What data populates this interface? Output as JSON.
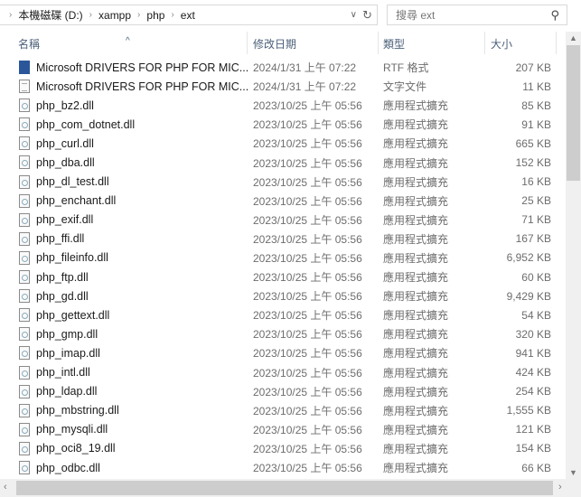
{
  "address": {
    "crumbs": [
      "本機磁碟 (D:)",
      "xampp",
      "php",
      "ext"
    ]
  },
  "search": {
    "placeholder": "搜尋 ext"
  },
  "columns": {
    "name": "名稱",
    "date": "修改日期",
    "type": "類型",
    "size": "大小"
  },
  "files": [
    {
      "name": "Microsoft DRIVERS FOR PHP FOR MIC...",
      "date": "2024/1/31 上午 07:22",
      "type": "RTF 格式",
      "size": "207 KB",
      "icon": "word"
    },
    {
      "name": "Microsoft DRIVERS FOR PHP FOR MIC...",
      "date": "2024/1/31 上午 07:22",
      "type": "文字文件",
      "size": "11 KB",
      "icon": "txt"
    },
    {
      "name": "php_bz2.dll",
      "date": "2023/10/25 上午 05:56",
      "type": "應用程式擴充",
      "size": "85 KB",
      "icon": "dll"
    },
    {
      "name": "php_com_dotnet.dll",
      "date": "2023/10/25 上午 05:56",
      "type": "應用程式擴充",
      "size": "91 KB",
      "icon": "dll"
    },
    {
      "name": "php_curl.dll",
      "date": "2023/10/25 上午 05:56",
      "type": "應用程式擴充",
      "size": "665 KB",
      "icon": "dll"
    },
    {
      "name": "php_dba.dll",
      "date": "2023/10/25 上午 05:56",
      "type": "應用程式擴充",
      "size": "152 KB",
      "icon": "dll"
    },
    {
      "name": "php_dl_test.dll",
      "date": "2023/10/25 上午 05:56",
      "type": "應用程式擴充",
      "size": "16 KB",
      "icon": "dll"
    },
    {
      "name": "php_enchant.dll",
      "date": "2023/10/25 上午 05:56",
      "type": "應用程式擴充",
      "size": "25 KB",
      "icon": "dll"
    },
    {
      "name": "php_exif.dll",
      "date": "2023/10/25 上午 05:56",
      "type": "應用程式擴充",
      "size": "71 KB",
      "icon": "dll"
    },
    {
      "name": "php_ffi.dll",
      "date": "2023/10/25 上午 05:56",
      "type": "應用程式擴充",
      "size": "167 KB",
      "icon": "dll"
    },
    {
      "name": "php_fileinfo.dll",
      "date": "2023/10/25 上午 05:56",
      "type": "應用程式擴充",
      "size": "6,952 KB",
      "icon": "dll"
    },
    {
      "name": "php_ftp.dll",
      "date": "2023/10/25 上午 05:56",
      "type": "應用程式擴充",
      "size": "60 KB",
      "icon": "dll"
    },
    {
      "name": "php_gd.dll",
      "date": "2023/10/25 上午 05:56",
      "type": "應用程式擴充",
      "size": "9,429 KB",
      "icon": "dll"
    },
    {
      "name": "php_gettext.dll",
      "date": "2023/10/25 上午 05:56",
      "type": "應用程式擴充",
      "size": "54 KB",
      "icon": "dll"
    },
    {
      "name": "php_gmp.dll",
      "date": "2023/10/25 上午 05:56",
      "type": "應用程式擴充",
      "size": "320 KB",
      "icon": "dll"
    },
    {
      "name": "php_imap.dll",
      "date": "2023/10/25 上午 05:56",
      "type": "應用程式擴充",
      "size": "941 KB",
      "icon": "dll"
    },
    {
      "name": "php_intl.dll",
      "date": "2023/10/25 上午 05:56",
      "type": "應用程式擴充",
      "size": "424 KB",
      "icon": "dll"
    },
    {
      "name": "php_ldap.dll",
      "date": "2023/10/25 上午 05:56",
      "type": "應用程式擴充",
      "size": "254 KB",
      "icon": "dll"
    },
    {
      "name": "php_mbstring.dll",
      "date": "2023/10/25 上午 05:56",
      "type": "應用程式擴充",
      "size": "1,555 KB",
      "icon": "dll"
    },
    {
      "name": "php_mysqli.dll",
      "date": "2023/10/25 上午 05:56",
      "type": "應用程式擴充",
      "size": "121 KB",
      "icon": "dll"
    },
    {
      "name": "php_oci8_19.dll",
      "date": "2023/10/25 上午 05:56",
      "type": "應用程式擴充",
      "size": "154 KB",
      "icon": "dll"
    },
    {
      "name": "php_odbc.dll",
      "date": "2023/10/25 上午 05:56",
      "type": "應用程式擴充",
      "size": "66 KB",
      "icon": "dll"
    }
  ]
}
